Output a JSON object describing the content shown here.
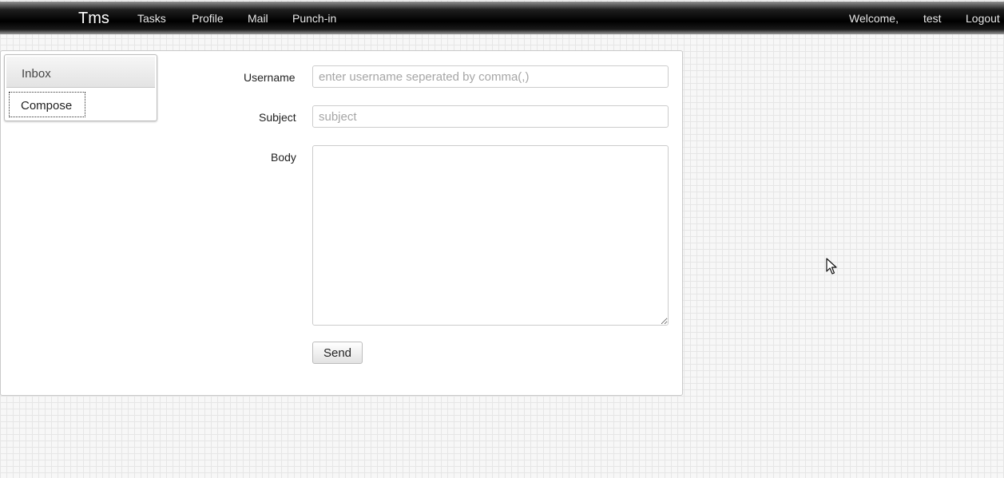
{
  "navbar": {
    "brand": "Tms",
    "links": [
      "Tasks",
      "Profile",
      "Mail",
      "Punch-in"
    ],
    "welcome": "Welcome,",
    "username": "test",
    "logout": "Logout"
  },
  "sidebar": {
    "inbox": "Inbox",
    "compose": "Compose"
  },
  "form": {
    "username_label": "Username",
    "username_placeholder": "enter username seperated by comma(,)",
    "username_value": "",
    "subject_label": "Subject",
    "subject_placeholder": "subject",
    "subject_value": "",
    "body_label": "Body",
    "body_value": "",
    "send_label": "Send"
  },
  "icons": {
    "cursor": "mouse-pointer"
  }
}
